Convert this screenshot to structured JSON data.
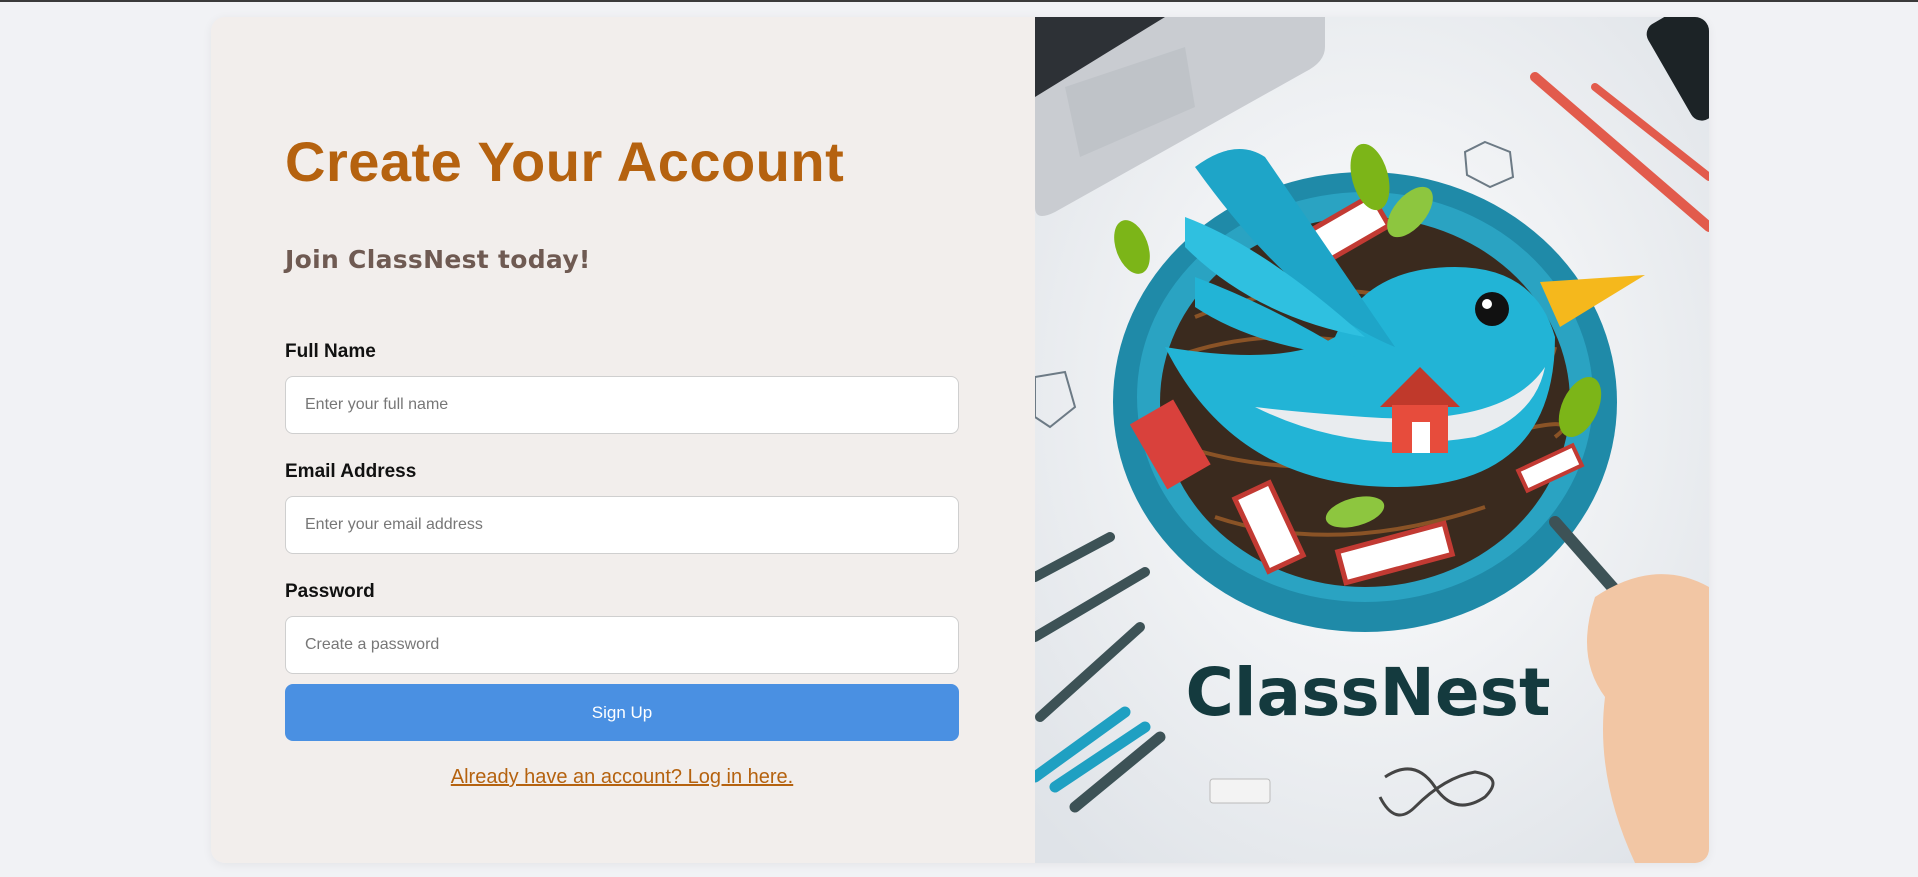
{
  "signup": {
    "title": "Create Your Account",
    "subtitle": "Join ClassNest today!",
    "fields": [
      {
        "label": "Full Name",
        "placeholder": "Enter your full name",
        "value": ""
      },
      {
        "label": "Email Address",
        "placeholder": "Enter your email address",
        "value": ""
      },
      {
        "label": "Password",
        "placeholder": "Create a password",
        "value": ""
      }
    ],
    "submit_label": "Sign Up",
    "login_link": "Already have an account? Log in here."
  },
  "illustration": {
    "brand_text": "ClassNest",
    "icon": "bird-nest-logo",
    "colors": {
      "bird": "#22b4d6",
      "nest": "#1f8aa8",
      "beak": "#f5b81c",
      "brand_text": "#143a3e"
    }
  },
  "theme": {
    "accent": "#b5620f",
    "button": "#4a90e2",
    "panel_bg": "#f2eeec",
    "page_bg": "#f1f2f5"
  }
}
